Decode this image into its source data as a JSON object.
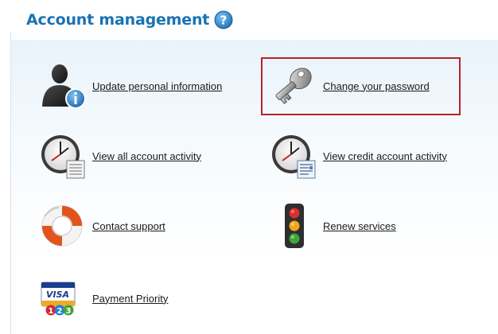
{
  "header": {
    "title": "Account management",
    "help_icon": "question-circle-icon"
  },
  "colors": {
    "title": "#1a72b3",
    "highlight_border": "#b3252c",
    "panel_top": "#e9f3fb"
  },
  "items": [
    {
      "label": "Update personal information",
      "icon": "user-info-icon"
    },
    {
      "label": "Change your password",
      "icon": "key-icon",
      "highlighted": true
    },
    {
      "label": "View all account activity",
      "icon": "clock-document-icon"
    },
    {
      "label": "View credit account activity",
      "icon": "clock-ledger-icon"
    },
    {
      "label": "Contact support",
      "icon": "lifebuoy-icon"
    },
    {
      "label": "Renew services",
      "icon": "traffic-light-icon"
    },
    {
      "label": "Payment Priority",
      "icon": "visa-123-icon"
    }
  ]
}
